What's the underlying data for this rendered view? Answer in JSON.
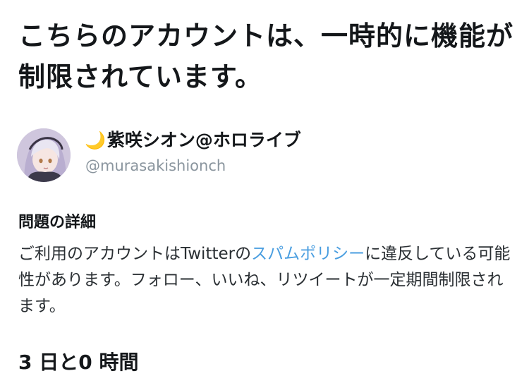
{
  "notice": {
    "title": "こちらのアカウントは、一時的に機能が制限されています。"
  },
  "account": {
    "display_name": "紫咲シオン@ホロライブ",
    "name_emoji": "🌙",
    "handle": "@murasakishionch",
    "avatar_icon": "profile-avatar"
  },
  "details": {
    "heading": "問題の詳細",
    "body_before_link": "ご利用のアカウントはTwitterの",
    "policy_link": "スパムポリシー",
    "body_after_link": "に違反している可能性があります。フォロー、いいね、リツイートが一定期間制限されます。"
  },
  "remaining": {
    "text": "3 日と0 時間"
  },
  "colors": {
    "text": "#14171a",
    "secondary": "#8a959e",
    "link": "#4a9ee0"
  }
}
